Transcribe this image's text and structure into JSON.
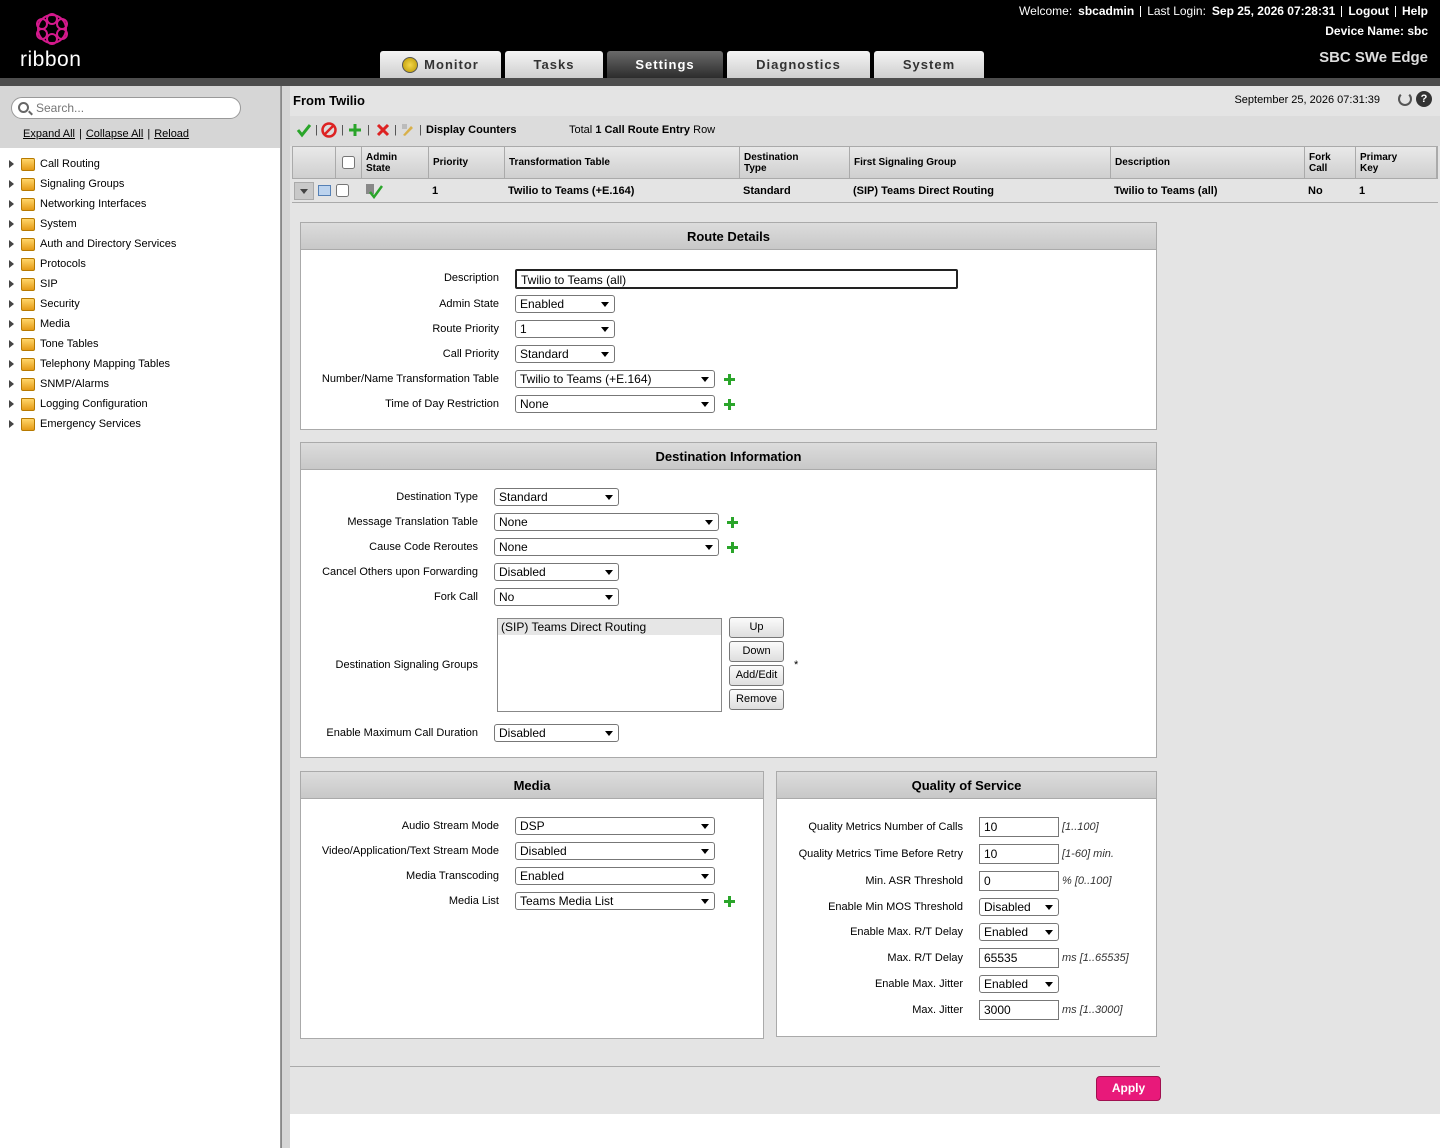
{
  "header": {
    "logo_text": "ribbon",
    "welcome_label": "Welcome:",
    "user": "sbcadmin",
    "last_login_label": "Last Login:",
    "last_login": "Sep 25, 2026 07:28:31",
    "logout": "Logout",
    "help": "Help",
    "device_name_label": "Device Name:",
    "device_name": "sbc",
    "product": "SBC SWe Edge"
  },
  "tabs": [
    {
      "label": "Monitor",
      "active": false
    },
    {
      "label": "Tasks",
      "active": false
    },
    {
      "label": "Settings",
      "active": true
    },
    {
      "label": "Diagnostics",
      "active": false
    },
    {
      "label": "System",
      "active": false
    }
  ],
  "sidebar": {
    "search_placeholder": "Search...",
    "expand_all": "Expand All",
    "collapse_all": "Collapse All",
    "reload": "Reload",
    "items": [
      "Call Routing",
      "Signaling Groups",
      "Networking Interfaces",
      "System",
      "Auth and Directory Services",
      "Protocols",
      "SIP",
      "Security",
      "Media",
      "Tone Tables",
      "Telephony Mapping Tables",
      "SNMP/Alarms",
      "Logging Configuration",
      "Emergency Services"
    ]
  },
  "page": {
    "title": "From Twilio",
    "datetime": "September 25, 2026 07:31:39",
    "help_glyph": "?",
    "display_counters": "Display Counters",
    "total_prefix": "Total",
    "total_count": "1 Call Route Entry",
    "total_suffix": "Row"
  },
  "grid": {
    "headers": {
      "admin_state": "Admin\nState",
      "priority": "Priority",
      "transformation_table": "Transformation Table",
      "destination_type": "Destination\nType",
      "first_signaling_group": "First Signaling Group",
      "description": "Description",
      "fork_call": "Fork\nCall",
      "primary_key": "Primary\nKey"
    },
    "row": {
      "priority": "1",
      "transformation_table": "Twilio to Teams (+E.164)",
      "destination_type": "Standard",
      "first_signaling_group": "(SIP) Teams Direct Routing",
      "description": "Twilio to Teams (all)",
      "fork_call": "No",
      "primary_key": "1"
    }
  },
  "route_details": {
    "title": "Route Details",
    "description_label": "Description",
    "description_value": "Twilio to Teams (all)",
    "admin_state_label": "Admin State",
    "admin_state_value": "Enabled",
    "route_priority_label": "Route Priority",
    "route_priority_value": "1",
    "call_priority_label": "Call Priority",
    "call_priority_value": "Standard",
    "transformation_label": "Number/Name Transformation Table",
    "transformation_value": "Twilio to Teams (+E.164)",
    "tod_label": "Time of Day Restriction",
    "tod_value": "None"
  },
  "destination": {
    "title": "Destination Information",
    "dest_type_label": "Destination Type",
    "dest_type_value": "Standard",
    "msg_translation_label": "Message Translation Table",
    "msg_translation_value": "None",
    "cause_code_label": "Cause Code Reroutes",
    "cause_code_value": "None",
    "cancel_others_label": "Cancel Others upon Forwarding",
    "cancel_others_value": "Disabled",
    "fork_call_label": "Fork Call",
    "fork_call_value": "No",
    "dsg_label": "Destination Signaling Groups",
    "dsg_items": [
      "(SIP) Teams Direct Routing"
    ],
    "btn_up": "Up",
    "btn_down": "Down",
    "btn_addedit": "Add/Edit",
    "btn_remove": "Remove",
    "required_mark": "*",
    "max_duration_label": "Enable Maximum Call Duration",
    "max_duration_value": "Disabled"
  },
  "media": {
    "title": "Media",
    "audio_label": "Audio Stream Mode",
    "audio_value": "DSP",
    "video_label": "Video/Application/Text Stream Mode",
    "video_value": "Disabled",
    "transcoding_label": "Media Transcoding",
    "transcoding_value": "Enabled",
    "media_list_label": "Media List",
    "media_list_value": "Teams Media List"
  },
  "qos": {
    "title": "Quality of Service",
    "calls_label": "Quality Metrics Number of Calls",
    "calls_value": "10",
    "calls_hint": "[1..100]",
    "retry_label": "Quality Metrics Time Before Retry",
    "retry_value": "10",
    "retry_hint": "[1-60] min.",
    "asr_label": "Min. ASR Threshold",
    "asr_value": "0",
    "asr_hint": "% [0..100]",
    "mos_label": "Enable Min MOS Threshold",
    "mos_value": "Disabled",
    "rt_enable_label": "Enable Max. R/T Delay",
    "rt_enable_value": "Enabled",
    "rt_label": "Max. R/T Delay",
    "rt_value": "65535",
    "rt_hint": "ms [1..65535]",
    "jitter_enable_label": "Enable Max. Jitter",
    "jitter_enable_value": "Enabled",
    "jitter_label": "Max. Jitter",
    "jitter_value": "3000",
    "jitter_hint": "ms [1..3000]"
  },
  "apply": "Apply"
}
